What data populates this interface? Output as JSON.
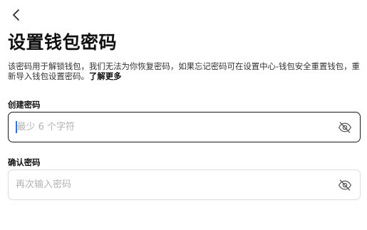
{
  "header": {
    "back_icon": "chevron-left-icon",
    "title": "设置钱包密码"
  },
  "description": {
    "text": "该密码用于解锁钱包，我们无法为你恢复密码，如果忘记密码可在设置中心-钱包安全重置钱包，重新导入钱包设置密码。",
    "link_label": "了解更多"
  },
  "create_password": {
    "label": "创建密码",
    "value": "",
    "placeholder": "最少 6 个字符",
    "toggle_icon": "eye-off-icon",
    "focused": true,
    "border_color": "#1a1a1a"
  },
  "confirm_password": {
    "label": "确认密码",
    "value": "",
    "placeholder": "再次输入密码",
    "toggle_icon": "eye-off-icon",
    "border_color": "#dcdcdc"
  },
  "colors": {
    "caret": "#3b6fd8",
    "placeholder": "#b3b3b3",
    "text": "#111111"
  }
}
